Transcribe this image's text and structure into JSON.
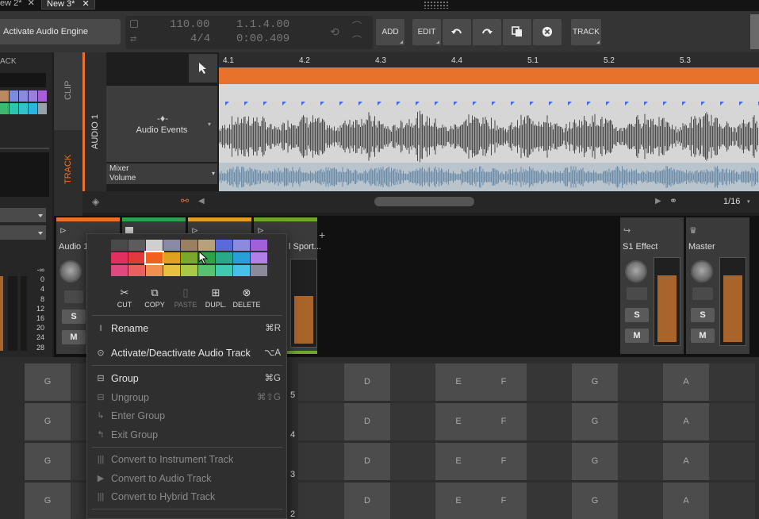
{
  "tabs": [
    {
      "label": "ew 2*"
    },
    {
      "label": "New 3*"
    }
  ],
  "toolbar": {
    "engine_button": "Activate Audio Engine",
    "transport": {
      "tempo": "110.00",
      "signature": "4/4",
      "position": "1.1.4.00",
      "time": "0:00.409"
    },
    "add": "ADD",
    "edit": "EDIT",
    "track": "TRACK"
  },
  "inspector": {
    "header": "ACK",
    "palette_colors": [
      "#b88a5e",
      "#7b8be0",
      "#9b7fe0",
      "#aa5cdb",
      "#3db86e",
      "#2fc4b0",
      "#2db3e0",
      "#9aa0a8"
    ]
  },
  "arranger": {
    "clip_label": "CLIP",
    "track_label": "TRACK",
    "track_name": "AUDIO 1",
    "audio_events": "Audio Events",
    "mixer_volume": "Mixer\nVolume",
    "mixer_line1": "Mixer",
    "mixer_line2": "Volume",
    "ruler": [
      "4.1",
      "4.2",
      "4.3",
      "4.4",
      "5.1",
      "5.2",
      "5.3"
    ],
    "grid": "1/16"
  },
  "mixer": {
    "channels": [
      {
        "name": "Audio 1",
        "color": "#e8722b"
      },
      {
        "name": "",
        "color": "#2e9e52"
      },
      {
        "name": "",
        "color": "#d9a227"
      },
      {
        "name": "l Sport...",
        "color": "#6ea630"
      },
      {
        "name": "S1 Effect",
        "color": "#3a3a3a"
      },
      {
        "name": "Master",
        "color": "#3a3a3a"
      }
    ],
    "meter_scale": [
      "-∞",
      "0",
      "4",
      "8",
      "12",
      "16",
      "20",
      "24",
      "28"
    ],
    "solo": "S",
    "mute": "M",
    "add_icon": "+"
  },
  "grid": {
    "rows": [
      {
        "num": "5"
      },
      {
        "num": "4"
      },
      {
        "num": "3"
      },
      {
        "num": "2"
      }
    ],
    "notes": [
      "G",
      "D",
      "E",
      "F",
      "G",
      "A"
    ]
  },
  "context_menu": {
    "palette": [
      [
        "#4a4a4a",
        "#5c5c5c",
        "#cfcfcf",
        "#8a8aa8",
        "#9a8060",
        "#b8a07a",
        "#5a6ad8",
        "#8a8ae0",
        "#a060d8"
      ],
      [
        "#e03060",
        "#e23a3a",
        "#f0601e",
        "#e0a020",
        "#7aa82a",
        "#30a04a",
        "#2aa88a",
        "#2a9ed8",
        "#b080e8"
      ],
      [
        "#e04880",
        "#e86060",
        "#f09050",
        "#e8c040",
        "#a8c848",
        "#58c070",
        "#40c8b0",
        "#48c0e8",
        "#8a8a9a"
      ]
    ],
    "actions": [
      {
        "icon": "✂",
        "label": "CUT"
      },
      {
        "icon": "⧉",
        "label": "COPY"
      },
      {
        "icon": "📋",
        "label": "PASTE"
      },
      {
        "icon": "⊞",
        "label": "DUPL."
      },
      {
        "icon": "⊗",
        "label": "DELETE"
      }
    ],
    "items": [
      {
        "icon": "I",
        "label": "Rename",
        "shortcut": "⌘R"
      },
      {
        "icon": "⊙",
        "label": "Activate/Deactivate Audio Track",
        "shortcut": "⌥A"
      },
      {
        "icon": "⊟",
        "label": "Group",
        "shortcut": "⌘G"
      },
      {
        "icon": "⊟",
        "label": "Ungroup",
        "shortcut": "⌘⇧G"
      },
      {
        "icon": "↳",
        "label": "Enter Group",
        "shortcut": ""
      },
      {
        "icon": "↰",
        "label": "Exit Group",
        "shortcut": ""
      },
      {
        "icon": "|||",
        "label": "Convert to Instrument Track",
        "shortcut": ""
      },
      {
        "icon": "▶",
        "label": "Convert to Audio Track",
        "shortcut": ""
      },
      {
        "icon": "|||",
        "label": "Convert to Hybrid Track",
        "shortcut": ""
      }
    ]
  }
}
